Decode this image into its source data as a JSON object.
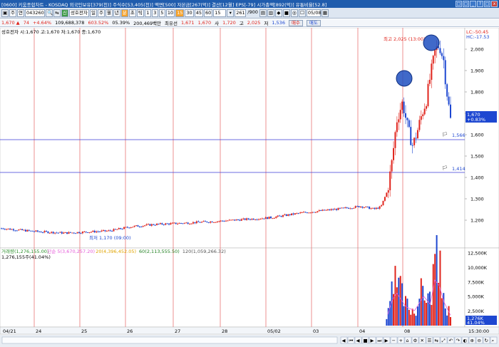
{
  "title_bar": "[0600] 키움종합차트 - KOSDAQ 외국인보유[379(천)] 주식수[53,405(천)] 액면[500] 자본금[267(억)] 결산[12월] EPS[-79] 시가총액[892(억)] 유통비율[52.8]",
  "window_buttons": [
    "□",
    "□",
    "_",
    "?",
    "□",
    "x"
  ],
  "toolbar": {
    "code_type": "주",
    "mode": "연",
    "stock_code": "043260",
    "stock_name": "성호전자",
    "tag": "신",
    "periods": [
      "일",
      "주",
      "월",
      "년",
      "분",
      "초",
      "틱"
    ],
    "active_period": "분",
    "intervals": [
      "1",
      "3",
      "5",
      "10",
      "15",
      "30",
      "45",
      "60"
    ],
    "active_interval": "15",
    "interval_select": "15",
    "count": "261",
    "total": "/900",
    "date": "05/08"
  },
  "infobar": {
    "price": "1,670",
    "change": "74",
    "change_pct": "+4.64%",
    "volume": "109,688,378",
    "vol_rate": "603.52%",
    "turnover_pct": "05.39%",
    "amount": "200,469백만",
    "holder": "최유선",
    "v1": "1,671",
    "v2": "1,670",
    "high_label": "사",
    "high": "1,720",
    "high2_label": "고",
    "high2": "2,025",
    "low_label": "저",
    "low": "1,536",
    "buy_button": "매수",
    "sell_button": "매도"
  },
  "price_panel": {
    "header": "성호전자 시:1,670 고:1,670 저:1,670 종:1,670",
    "lc": "LC:-50.45",
    "hc": "HC:-17.53",
    "max_label": "최고 2,025 (13:00)",
    "min_label": "최저 1,170 (09:00)",
    "current_price": "1,670",
    "current_change": "+0.83%",
    "line1_label": "1,566",
    "line2_label": "1,414",
    "ticks": [
      "2,000",
      "1,900",
      "1,800",
      "1,700",
      "1,600",
      "1,500",
      "1,400",
      "1,300",
      "1,200"
    ]
  },
  "volume_panel": {
    "header": [
      {
        "text": "거래량(1,276,155.00)",
        "color": "#2b8f2b"
      },
      {
        "text": "단순 5(3,670,257.20)",
        "color": "#e45ad8"
      },
      {
        "text": "20(4,396,452.05)",
        "color": "#e0a400"
      },
      {
        "text": "60(2,113,555.50)",
        "color": "#1f7f1f"
      },
      {
        "text": "120(1,059,266.32)",
        "color": "#555555"
      }
    ],
    "sub": "1,276,155주(41.04%)",
    "ticks": [
      "12,500K",
      "10,000K",
      "7,500K",
      "5,000K",
      "2,500K"
    ],
    "current": "1,276K",
    "current_pct": "41.04%"
  },
  "x_axis": [
    "04/21",
    "24",
    "25",
    "26",
    "27",
    "28",
    "05/02",
    "03",
    "04",
    "08"
  ],
  "time_label": "15:30:00",
  "colors": {
    "up": "#e0241c",
    "down": "#1d47d1",
    "accent": "#1f5cad"
  },
  "chart_data": {
    "type": "candlestick",
    "title": "성호전자",
    "ylim": [
      1100,
      2050
    ],
    "price_profile": [
      [
        0,
        1162
      ],
      [
        0.07,
        1148
      ],
      [
        0.14,
        1140
      ],
      [
        0.17,
        1143
      ],
      [
        0.24,
        1150
      ],
      [
        0.29,
        1170
      ],
      [
        0.34,
        1180
      ],
      [
        0.42,
        1188
      ],
      [
        0.48,
        1195
      ],
      [
        0.55,
        1205
      ],
      [
        0.6,
        1212
      ],
      [
        0.64,
        1225
      ],
      [
        0.67,
        1235
      ],
      [
        0.74,
        1250
      ],
      [
        0.8,
        1265
      ],
      [
        0.83,
        1252
      ],
      [
        0.845,
        1262
      ],
      [
        0.86,
        1340
      ],
      [
        0.87,
        1480
      ],
      [
        0.88,
        1665
      ],
      [
        0.893,
        1752
      ],
      [
        0.906,
        1620
      ],
      [
        0.916,
        1548
      ],
      [
        0.926,
        1615
      ],
      [
        0.936,
        1695
      ],
      [
        0.946,
        1760
      ],
      [
        0.956,
        1885
      ],
      [
        0.966,
        1992
      ],
      [
        0.975,
        2020
      ],
      [
        0.985,
        1945
      ],
      [
        0.99,
        1830
      ],
      [
        1.0,
        1670
      ]
    ],
    "volume_profile": [
      [
        0,
        0.2
      ],
      [
        0.84,
        0.2
      ],
      [
        0.86,
        1.5
      ],
      [
        0.87,
        5.5
      ],
      [
        0.88,
        7.8
      ],
      [
        0.9,
        3.8
      ],
      [
        0.92,
        2.6
      ],
      [
        0.94,
        6.8
      ],
      [
        0.955,
        4.4
      ],
      [
        0.965,
        11.4
      ],
      [
        0.975,
        9.8
      ],
      [
        0.985,
        5.2
      ],
      [
        1.0,
        1.3
      ]
    ],
    "volume_ylim": [
      0,
      12500
    ]
  }
}
